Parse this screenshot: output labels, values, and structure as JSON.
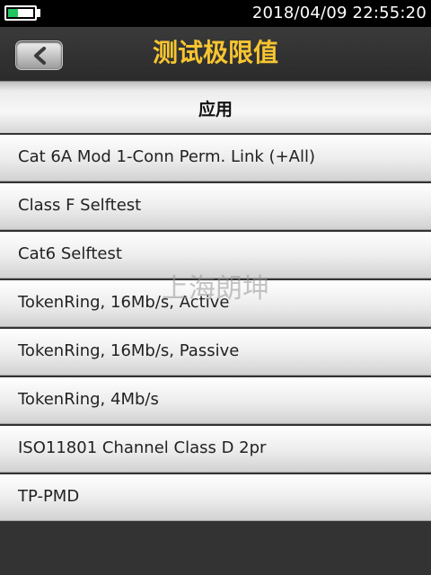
{
  "status": {
    "battery_level": 0.4,
    "battery_color": "#22c55e",
    "time": "2018/04/09  22:55:20"
  },
  "header": {
    "title": "测试极限值",
    "title_color": "#f7c531",
    "back_icon": "chevron-left-icon"
  },
  "list": {
    "header": "应用",
    "items": [
      "Cat 6A Mod 1-Conn Perm. Link (+All)",
      "Class F Selftest",
      "Cat6 Selftest",
      "TokenRing, 16Mb/s, Active",
      "TokenRing, 16Mb/s, Passive",
      "TokenRing, 4Mb/s",
      "ISO11801 Channel Class D 2pr",
      "TP-PMD"
    ]
  },
  "watermark": "上海朗坤"
}
